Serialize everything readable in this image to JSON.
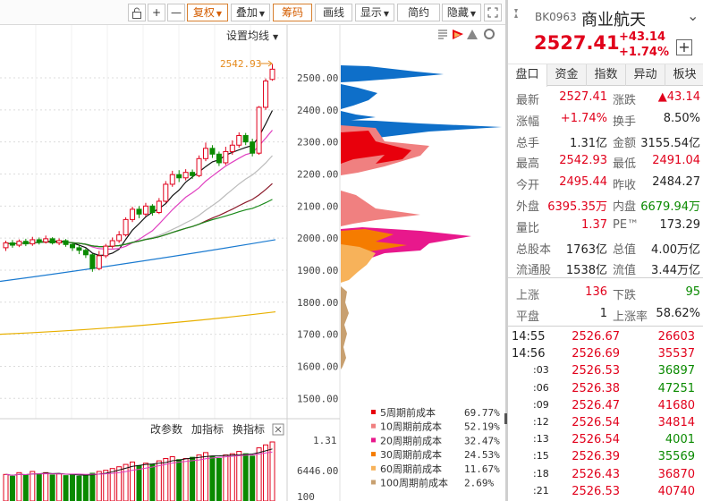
{
  "toolbar": {
    "buttons": [
      "复权",
      "叠加",
      "筹码",
      "画线",
      "显示",
      "简约",
      "隐藏"
    ],
    "plus": "+",
    "minus": "—"
  },
  "chart": {
    "ma_setting": "设置均线",
    "high_label": "2542.93",
    "price_ticks": [
      "2500.00",
      "2400.00",
      "2300.00",
      "2200.00",
      "2100.00",
      "2000.00",
      "1900.00",
      "1800.00",
      "1700.00",
      "1600.00",
      "1500.00"
    ],
    "indicator_buttons": [
      "改参数",
      "加指标",
      "换指标"
    ],
    "vol_ticks": [
      "1.31",
      "6446.00",
      "100"
    ],
    "legend": [
      {
        "label": "5周期前成本",
        "pct": "69.77%",
        "color": "#e8000c"
      },
      {
        "label": "10周期前成本",
        "pct": "52.19%",
        "color": "#f08080"
      },
      {
        "label": "20周期前成本",
        "pct": "32.47%",
        "color": "#e8188c"
      },
      {
        "label": "30周期前成本",
        "pct": "24.53%",
        "color": "#f57c00"
      },
      {
        "label": "60周期前成本",
        "pct": "11.67%",
        "color": "#f7b25a"
      },
      {
        "label": "100周期前成本",
        "pct": "2.69%",
        "color": "#c8a070"
      }
    ]
  },
  "quote": {
    "code": "BK0963",
    "name": "商业航天",
    "price": "2527.41",
    "change": "+43.14",
    "change_pct": "+1.74%",
    "add": "+"
  },
  "tabs": [
    "盘口",
    "资金",
    "指数",
    "异动",
    "板块"
  ],
  "stats": [
    {
      "l1": "最新",
      "v1": "2527.41",
      "c1": "red",
      "l2": "涨跌",
      "v2": "▲43.14",
      "c2": "red"
    },
    {
      "l1": "涨幅",
      "v1": "+1.74%",
      "c1": "red",
      "l2": "换手",
      "v2": "8.50%",
      "c2": "dark"
    },
    {
      "l1": "总手",
      "v1": "1.31亿",
      "c1": "dark",
      "l2": "金额",
      "v2": "3155.54亿",
      "c2": "dark"
    },
    {
      "l1": "最高",
      "v1": "2542.93",
      "c1": "red",
      "l2": "最低",
      "v2": "2491.04",
      "c2": "red"
    },
    {
      "l1": "今开",
      "v1": "2495.44",
      "c1": "red",
      "l2": "昨收",
      "v2": "2484.27",
      "c2": "dark"
    },
    {
      "l1": "外盘",
      "v1": "6395.35万",
      "c1": "red",
      "l2": "内盘",
      "v2": "6679.94万",
      "c2": "green"
    },
    {
      "l1": "量比",
      "v1": "1.37",
      "c1": "red",
      "l2": "PE™",
      "v2": "173.29",
      "c2": "dark"
    },
    {
      "l1": "总股本",
      "v1": "1763亿",
      "c1": "dark",
      "l2": "总值",
      "v2": "4.00万亿",
      "c2": "dark"
    },
    {
      "l1": "流通股",
      "v1": "1538亿",
      "c1": "dark",
      "l2": "流值",
      "v2": "3.44万亿",
      "c2": "dark"
    },
    {
      "l1": "上涨",
      "v1": "136",
      "c1": "red",
      "l2": "下跌",
      "v2": "95",
      "c2": "green"
    },
    {
      "l1": "平盘",
      "v1": "1",
      "c1": "dark",
      "l2": "上涨率",
      "v2": "58.62%",
      "c2": "dark"
    }
  ],
  "ticks": [
    {
      "t": "14:55",
      "p": "2526.67",
      "v": "26603",
      "vc": "red"
    },
    {
      "t": "14:56",
      "p": "2526.69",
      "v": "35537",
      "vc": "red"
    },
    {
      "t": ":03",
      "p": "2526.53",
      "v": "36897",
      "vc": "green"
    },
    {
      "t": ":06",
      "p": "2526.38",
      "v": "47251",
      "vc": "green"
    },
    {
      "t": ":09",
      "p": "2526.47",
      "v": "41680",
      "vc": "red"
    },
    {
      "t": ":12",
      "p": "2526.54",
      "v": "34814",
      "vc": "red"
    },
    {
      "t": ":13",
      "p": "2526.54",
      "v": "4001",
      "vc": "green"
    },
    {
      "t": ":15",
      "p": "2526.39",
      "v": "35569",
      "vc": "green"
    },
    {
      "t": ":18",
      "p": "2526.43",
      "v": "36870",
      "vc": "red"
    },
    {
      "t": ":21",
      "p": "2526.53",
      "v": "40740",
      "vc": "red"
    }
  ],
  "chart_data": {
    "type": "candlestick",
    "price_axis": [
      1500,
      2550
    ],
    "high": 2542.93,
    "candles": [
      [
        1970,
        1985,
        1960,
        1992
      ],
      [
        1985,
        1978,
        1970,
        1994
      ],
      [
        1978,
        1990,
        1972,
        1996
      ],
      [
        1990,
        1982,
        1975,
        1998
      ],
      [
        1982,
        1995,
        1976,
        2004
      ],
      [
        1995,
        1988,
        1980,
        2002
      ],
      [
        1988,
        1998,
        1983,
        2008
      ],
      [
        1998,
        1985,
        1980,
        2003
      ],
      [
        1985,
        1992,
        1978,
        1999
      ],
      [
        1992,
        1980,
        1973,
        1997
      ],
      [
        1980,
        1970,
        1960,
        1987
      ],
      [
        1970,
        1962,
        1950,
        1978
      ],
      [
        1962,
        1948,
        1938,
        1968
      ],
      [
        1948,
        1905,
        1895,
        1952
      ],
      [
        1905,
        1945,
        1900,
        1960
      ],
      [
        1945,
        1975,
        1938,
        1982
      ],
      [
        1975,
        1992,
        1968,
        2002
      ],
      [
        1992,
        2010,
        1985,
        2022
      ],
      [
        2010,
        2058,
        2005,
        2065
      ],
      [
        2058,
        2090,
        2050,
        2098
      ],
      [
        2090,
        2075,
        2062,
        2100
      ],
      [
        2075,
        2100,
        2068,
        2110
      ],
      [
        2100,
        2080,
        2070,
        2106
      ],
      [
        2080,
        2115,
        2075,
        2125
      ],
      [
        2115,
        2168,
        2110,
        2178
      ],
      [
        2168,
        2198,
        2160,
        2210
      ],
      [
        2198,
        2188,
        2175,
        2212
      ],
      [
        2188,
        2205,
        2180,
        2215
      ],
      [
        2205,
        2195,
        2185,
        2214
      ],
      [
        2195,
        2248,
        2190,
        2258
      ],
      [
        2248,
        2280,
        2240,
        2298
      ],
      [
        2280,
        2262,
        2250,
        2290
      ],
      [
        2262,
        2235,
        2225,
        2270
      ],
      [
        2235,
        2270,
        2228,
        2285
      ],
      [
        2270,
        2290,
        2260,
        2305
      ],
      [
        2290,
        2320,
        2282,
        2330
      ],
      [
        2320,
        2300,
        2290,
        2328
      ],
      [
        2300,
        2265,
        2255,
        2310
      ],
      [
        2265,
        2408,
        2260,
        2412
      ],
      [
        2408,
        2490,
        2400,
        2498
      ],
      [
        2495,
        2527,
        2491,
        2543
      ]
    ],
    "volumes": [
      0.45,
      0.42,
      0.48,
      0.44,
      0.5,
      0.46,
      0.48,
      0.44,
      0.46,
      0.43,
      0.45,
      0.42,
      0.44,
      0.47,
      0.5,
      0.52,
      0.55,
      0.58,
      0.62,
      0.66,
      0.6,
      0.64,
      0.62,
      0.68,
      0.72,
      0.75,
      0.7,
      0.72,
      0.74,
      0.78,
      0.82,
      0.76,
      0.72,
      0.78,
      0.8,
      0.84,
      0.8,
      0.76,
      0.9,
      0.95,
      1.0
    ]
  }
}
